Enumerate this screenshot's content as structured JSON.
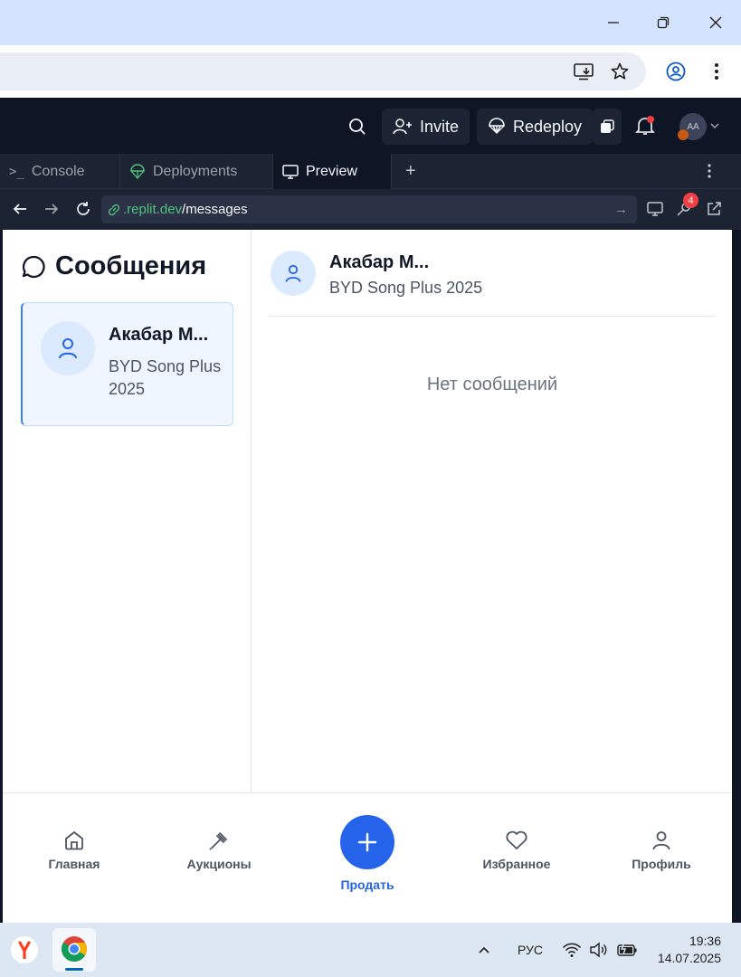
{
  "replit_topbar": {
    "invite_label": "Invite",
    "redeploy_label": "Redeploy",
    "avatar_initials": "AA"
  },
  "tabs": [
    {
      "label": "Console",
      "icon": "terminal-icon"
    },
    {
      "label": "Deployments",
      "icon": "deploy-icon"
    },
    {
      "label": "Preview",
      "icon": "monitor-icon"
    }
  ],
  "url_bar": {
    "domain": ".replit.dev",
    "path": "/messages",
    "devtools_badge": "4"
  },
  "messages_page": {
    "title": "Сообщения",
    "conversations": [
      {
        "name": "Акабар М...",
        "subtitle": "BYD Song Plus 2025"
      }
    ],
    "chat_header": {
      "name": "Акабар М...",
      "subtitle": "BYD Song Plus 2025"
    },
    "empty_state": "Нет сообщений"
  },
  "bottom_nav": {
    "items": [
      {
        "label": "Главная",
        "icon": "home-icon"
      },
      {
        "label": "Аукционы",
        "icon": "gavel-icon"
      },
      {
        "label": "Продать",
        "icon": "plus-icon"
      },
      {
        "label": "Избранное",
        "icon": "heart-icon"
      },
      {
        "label": "Профиль",
        "icon": "user-icon"
      }
    ]
  },
  "taskbar": {
    "language": "РУС",
    "time": "19:36",
    "date": "14.07.2025"
  },
  "colors": {
    "accent": "#2563eb",
    "replit_bg": "#0e1525",
    "link_green": "#4ec27e"
  }
}
